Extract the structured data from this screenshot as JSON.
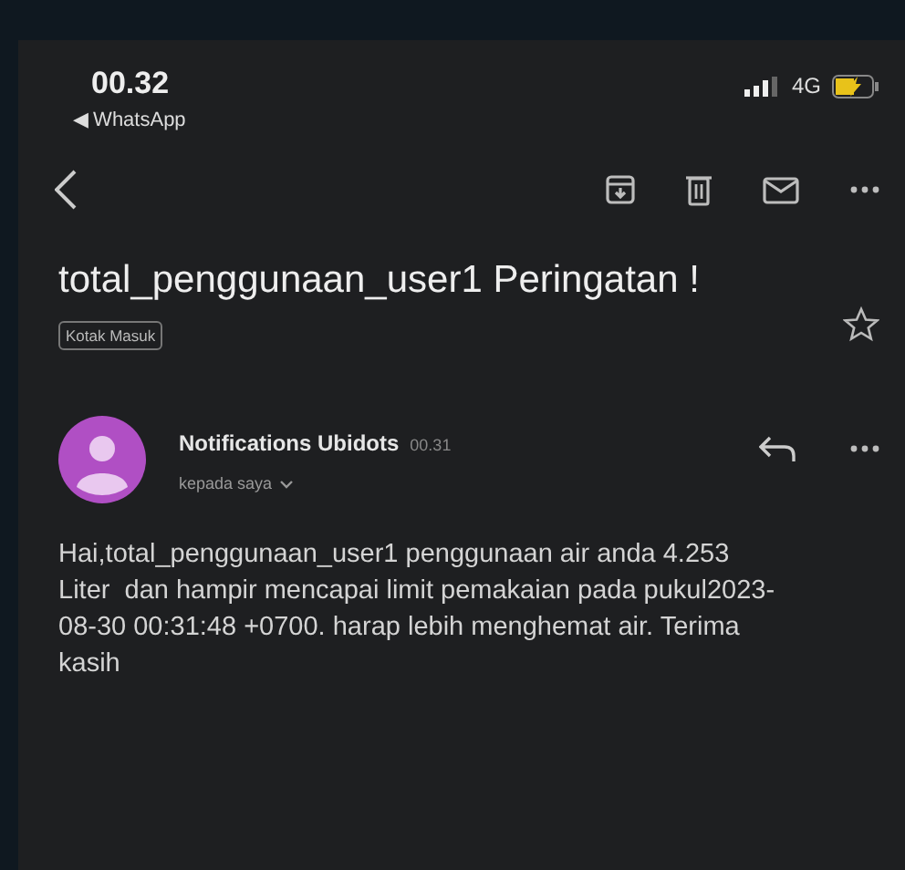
{
  "status_bar": {
    "time": "00.32",
    "back_app": "◀ WhatsApp",
    "network": "4G"
  },
  "message": {
    "subject": "total_penggunaan_user1 Peringatan !",
    "label": "Kotak Masuk",
    "starred": false,
    "sender": "Notifications Ubidots",
    "time": "00.31",
    "recipient": "kepada saya",
    "body": "Hai,total_penggunaan_user1 penggunaan air anda 4.253 Liter  dan hampir mencapai limit pemakaian pada pukul2023-08-30 00:31:48 +0700. harap lebih menghemat air. Terima kasih"
  }
}
